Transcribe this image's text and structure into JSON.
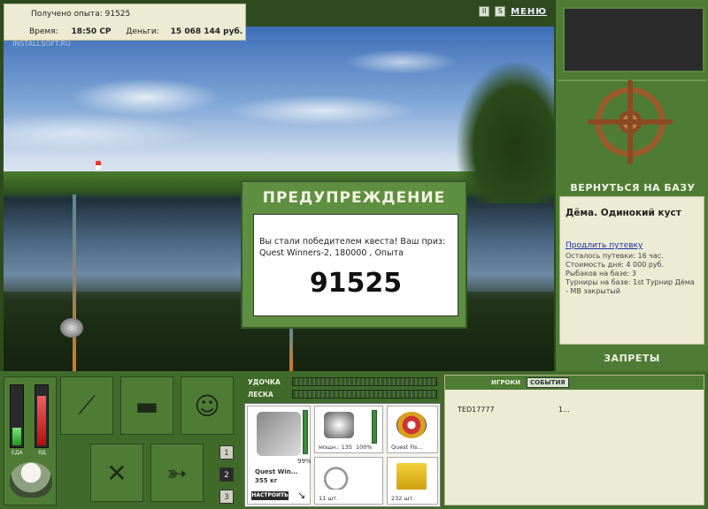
{
  "info": {
    "xp_label": "Получено опыта:",
    "xp_value": "91525",
    "time_label": "Время:",
    "time_value": "18:50 СР",
    "money_label": "Деньги:",
    "money_value": "15 068 144 руб."
  },
  "watermark": "INSTALLSOFT.RU",
  "topbar": {
    "pause": "II",
    "sound": "S",
    "menu": "МЕНЮ"
  },
  "right_panel": {
    "return_base": "ВЕРНУТЬСЯ НА БАЗУ",
    "location_title": "Дёма. Одинокий куст",
    "extend_link": "Продлить путевку",
    "lines": [
      "Осталось путевки: 16 час.",
      "Стоимость дня: 4 000 руб.",
      "Рыбаков на базе: 3",
      "Турниры на базе: 1st Турнир Дёма - МВ закрытый"
    ],
    "bans": "ЗАПРЕТЫ"
  },
  "dialog": {
    "title": "ПРЕДУПРЕЖДЕНИЕ",
    "message": "Вы стали победителем квеста! Ваш приз: Quest Winners-2, 180000 , Опыта",
    "value": "91525"
  },
  "meters": {
    "food_label": "ЕДА",
    "poison_label": "ЯД",
    "food_level": 0.3,
    "poison_level": 0.85
  },
  "slots": [
    "1",
    "2",
    "3"
  ],
  "tackle": {
    "rod_label": "УДОЧКА",
    "line_label": "ЛЕСКА",
    "rod_name": "Quest Win...",
    "rod_weight": "355 кг",
    "rod_pct": "99%",
    "setup": "НАСТРОИТЬ",
    "reel_cap": "мощн.: 135",
    "reel_pct": "100%",
    "line_cap": "Quest Fis...",
    "hook_cap": "11 шт.",
    "bait_cap": "232 шт."
  },
  "chat": {
    "tab_players": "ИГРОКИ",
    "tab_events": "СОБЫТИЯ",
    "row_name": "TED17777",
    "row_value": "1..."
  }
}
